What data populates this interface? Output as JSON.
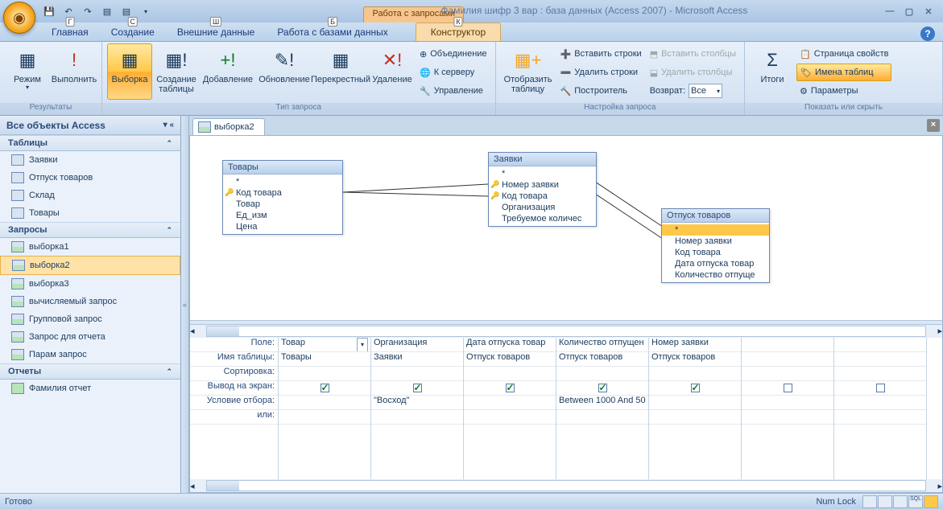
{
  "title": "Фамилия шифр 3 вар : база данных (Access 2007) - Microsoft Access",
  "context_tab_title": "Работа с запросами",
  "tabs": [
    "Главная",
    "Создание",
    "Внешние данные",
    "Работа с базами данных"
  ],
  "context_tab": "Конструктор",
  "keytips": {
    "home": "Г",
    "create": "С",
    "external": "Ш",
    "db": "Б",
    "design": "К"
  },
  "ribbon": {
    "group_results": "Результаты",
    "view": "Режим",
    "run": "Выполнить",
    "group_querytype": "Тип запроса",
    "select": "Выборка",
    "maketable": "Создание\nтаблицы",
    "append": "Добавление",
    "update": "Обновление",
    "crosstab": "Перекрестный",
    "delete": "Удаление",
    "union": "Объединение",
    "passthrough": "К серверу",
    "datadef": "Управление",
    "showtable": "Отобразить\nтаблицу",
    "group_querysetup": "Настройка запроса",
    "insert_rows": "Вставить строки",
    "delete_rows": "Удалить строки",
    "builder": "Построитель",
    "insert_cols": "Вставить столбцы",
    "delete_cols": "Удалить столбцы",
    "return_label": "Возврат:",
    "return_value": "Все",
    "totals": "Итоги",
    "group_showhide": "Показать или скрыть",
    "prop_sheet": "Страница свойств",
    "table_names": "Имена таблиц",
    "parameters": "Параметры"
  },
  "navpane": {
    "header": "Все объекты Access",
    "sec_tables": "Таблицы",
    "tables": [
      "Заявки",
      "Отпуск товаров",
      "Склад",
      "Товары"
    ],
    "sec_queries": "Запросы",
    "queries": [
      "выборка1",
      "выборка2",
      "выборка3",
      "вычисляемый запрос",
      "Групповой запрос",
      "Запрос для отчета",
      "Парам запрос"
    ],
    "selected_query": "выборка2",
    "sec_reports": "Отчеты",
    "reports": [
      "Фамилия отчет"
    ]
  },
  "doc_tab": "выборка2",
  "diagram": {
    "t1": {
      "title": "Товары",
      "fields": [
        "*",
        "Код товара",
        "Товар",
        "Ед_изм",
        "Цена"
      ],
      "keys": [
        1
      ]
    },
    "t2": {
      "title": "Заявки",
      "fields": [
        "*",
        "Номер заявки",
        "Код товара",
        "Организация",
        "Требуемое количес"
      ],
      "keys": [
        1,
        2
      ]
    },
    "t3": {
      "title": "Отпуск товаров",
      "fields": [
        "*",
        "Номер заявки",
        "Код товара",
        "Дата отпуска товар",
        "Количество отпуще"
      ],
      "keys": [],
      "selected": 0
    }
  },
  "grid": {
    "labels": [
      "Поле:",
      "Имя таблицы:",
      "Сортировка:",
      "Вывод на экран:",
      "Условие отбора:",
      "или:"
    ],
    "cols": [
      {
        "field": "Товар",
        "table": "Товары",
        "sort": "",
        "show": true,
        "crit": "",
        "or": "",
        "dropdown": true
      },
      {
        "field": "Организация",
        "table": "Заявки",
        "sort": "",
        "show": true,
        "crit": "\"Восход\"",
        "or": ""
      },
      {
        "field": "Дата отпуска товар",
        "table": "Отпуск товаров",
        "sort": "",
        "show": true,
        "crit": "",
        "or": ""
      },
      {
        "field": "Количество отпущен",
        "table": "Отпуск товаров",
        "sort": "",
        "show": true,
        "crit": "Between 1000 And 50",
        "or": ""
      },
      {
        "field": "Номер заявки",
        "table": "Отпуск товаров",
        "sort": "",
        "show": true,
        "crit": "",
        "or": ""
      },
      {
        "field": "",
        "table": "",
        "sort": "",
        "show": false,
        "crit": "",
        "or": ""
      },
      {
        "field": "",
        "table": "",
        "sort": "",
        "show": false,
        "crit": "",
        "or": ""
      }
    ]
  },
  "status": {
    "ready": "Готово",
    "numlock": "Num Lock"
  }
}
